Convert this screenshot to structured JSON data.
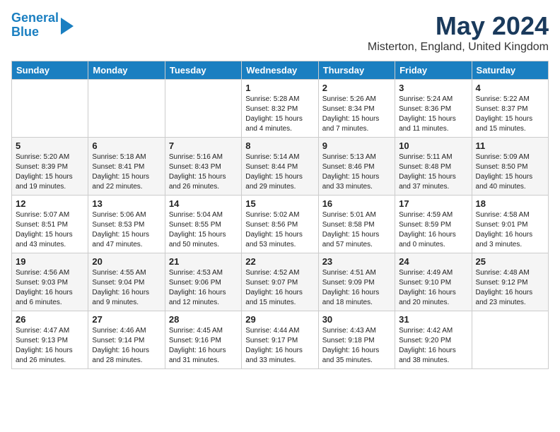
{
  "header": {
    "logo_line1": "General",
    "logo_line2": "Blue",
    "title": "May 2024",
    "subtitle": "Misterton, England, United Kingdom"
  },
  "days_of_week": [
    "Sunday",
    "Monday",
    "Tuesday",
    "Wednesday",
    "Thursday",
    "Friday",
    "Saturday"
  ],
  "weeks": [
    [
      {
        "day": "",
        "text": ""
      },
      {
        "day": "",
        "text": ""
      },
      {
        "day": "",
        "text": ""
      },
      {
        "day": "1",
        "text": "Sunrise: 5:28 AM\nSunset: 8:32 PM\nDaylight: 15 hours\nand 4 minutes."
      },
      {
        "day": "2",
        "text": "Sunrise: 5:26 AM\nSunset: 8:34 PM\nDaylight: 15 hours\nand 7 minutes."
      },
      {
        "day": "3",
        "text": "Sunrise: 5:24 AM\nSunset: 8:36 PM\nDaylight: 15 hours\nand 11 minutes."
      },
      {
        "day": "4",
        "text": "Sunrise: 5:22 AM\nSunset: 8:37 PM\nDaylight: 15 hours\nand 15 minutes."
      }
    ],
    [
      {
        "day": "5",
        "text": "Sunrise: 5:20 AM\nSunset: 8:39 PM\nDaylight: 15 hours\nand 19 minutes."
      },
      {
        "day": "6",
        "text": "Sunrise: 5:18 AM\nSunset: 8:41 PM\nDaylight: 15 hours\nand 22 minutes."
      },
      {
        "day": "7",
        "text": "Sunrise: 5:16 AM\nSunset: 8:43 PM\nDaylight: 15 hours\nand 26 minutes."
      },
      {
        "day": "8",
        "text": "Sunrise: 5:14 AM\nSunset: 8:44 PM\nDaylight: 15 hours\nand 29 minutes."
      },
      {
        "day": "9",
        "text": "Sunrise: 5:13 AM\nSunset: 8:46 PM\nDaylight: 15 hours\nand 33 minutes."
      },
      {
        "day": "10",
        "text": "Sunrise: 5:11 AM\nSunset: 8:48 PM\nDaylight: 15 hours\nand 37 minutes."
      },
      {
        "day": "11",
        "text": "Sunrise: 5:09 AM\nSunset: 8:50 PM\nDaylight: 15 hours\nand 40 minutes."
      }
    ],
    [
      {
        "day": "12",
        "text": "Sunrise: 5:07 AM\nSunset: 8:51 PM\nDaylight: 15 hours\nand 43 minutes."
      },
      {
        "day": "13",
        "text": "Sunrise: 5:06 AM\nSunset: 8:53 PM\nDaylight: 15 hours\nand 47 minutes."
      },
      {
        "day": "14",
        "text": "Sunrise: 5:04 AM\nSunset: 8:55 PM\nDaylight: 15 hours\nand 50 minutes."
      },
      {
        "day": "15",
        "text": "Sunrise: 5:02 AM\nSunset: 8:56 PM\nDaylight: 15 hours\nand 53 minutes."
      },
      {
        "day": "16",
        "text": "Sunrise: 5:01 AM\nSunset: 8:58 PM\nDaylight: 15 hours\nand 57 minutes."
      },
      {
        "day": "17",
        "text": "Sunrise: 4:59 AM\nSunset: 8:59 PM\nDaylight: 16 hours\nand 0 minutes."
      },
      {
        "day": "18",
        "text": "Sunrise: 4:58 AM\nSunset: 9:01 PM\nDaylight: 16 hours\nand 3 minutes."
      }
    ],
    [
      {
        "day": "19",
        "text": "Sunrise: 4:56 AM\nSunset: 9:03 PM\nDaylight: 16 hours\nand 6 minutes."
      },
      {
        "day": "20",
        "text": "Sunrise: 4:55 AM\nSunset: 9:04 PM\nDaylight: 16 hours\nand 9 minutes."
      },
      {
        "day": "21",
        "text": "Sunrise: 4:53 AM\nSunset: 9:06 PM\nDaylight: 16 hours\nand 12 minutes."
      },
      {
        "day": "22",
        "text": "Sunrise: 4:52 AM\nSunset: 9:07 PM\nDaylight: 16 hours\nand 15 minutes."
      },
      {
        "day": "23",
        "text": "Sunrise: 4:51 AM\nSunset: 9:09 PM\nDaylight: 16 hours\nand 18 minutes."
      },
      {
        "day": "24",
        "text": "Sunrise: 4:49 AM\nSunset: 9:10 PM\nDaylight: 16 hours\nand 20 minutes."
      },
      {
        "day": "25",
        "text": "Sunrise: 4:48 AM\nSunset: 9:12 PM\nDaylight: 16 hours\nand 23 minutes."
      }
    ],
    [
      {
        "day": "26",
        "text": "Sunrise: 4:47 AM\nSunset: 9:13 PM\nDaylight: 16 hours\nand 26 minutes."
      },
      {
        "day": "27",
        "text": "Sunrise: 4:46 AM\nSunset: 9:14 PM\nDaylight: 16 hours\nand 28 minutes."
      },
      {
        "day": "28",
        "text": "Sunrise: 4:45 AM\nSunset: 9:16 PM\nDaylight: 16 hours\nand 31 minutes."
      },
      {
        "day": "29",
        "text": "Sunrise: 4:44 AM\nSunset: 9:17 PM\nDaylight: 16 hours\nand 33 minutes."
      },
      {
        "day": "30",
        "text": "Sunrise: 4:43 AM\nSunset: 9:18 PM\nDaylight: 16 hours\nand 35 minutes."
      },
      {
        "day": "31",
        "text": "Sunrise: 4:42 AM\nSunset: 9:20 PM\nDaylight: 16 hours\nand 38 minutes."
      },
      {
        "day": "",
        "text": ""
      }
    ]
  ]
}
